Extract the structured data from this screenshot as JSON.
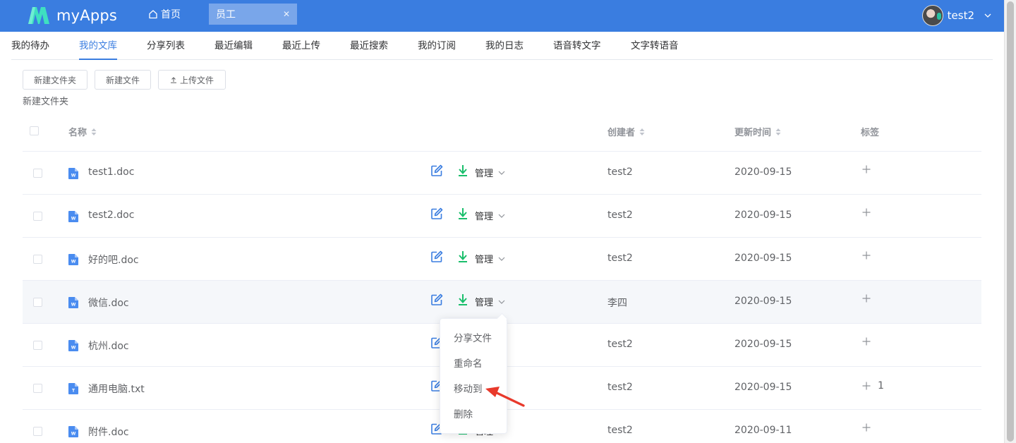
{
  "header": {
    "logo_text": "myApps",
    "home_label": "首页",
    "active_tab": "员工",
    "close_glyph": "✕",
    "username": "test2",
    "bar_color": "#3a7de0"
  },
  "nav": {
    "tabs": [
      {
        "label": "我的待办"
      },
      {
        "label": "我的文库"
      },
      {
        "label": "分享列表"
      },
      {
        "label": "最近编辑"
      },
      {
        "label": "最近上传"
      },
      {
        "label": "最近搜索"
      },
      {
        "label": "我的订阅"
      },
      {
        "label": "我的日志"
      },
      {
        "label": "语音转文字"
      },
      {
        "label": "文字转语音"
      }
    ],
    "active": "我的文库"
  },
  "toolbar": {
    "new_folder": "新建文件夹",
    "new_file": "新建文件",
    "upload": "上传文件"
  },
  "breadcrumb": "新建文件夹",
  "table": {
    "columns": {
      "name": "名称",
      "creator": "创建者",
      "updated": "更新时间",
      "tags": "标签"
    },
    "manage_label": "管理",
    "rows": [
      {
        "name": "test1.doc",
        "type": "doc",
        "creator": "test2",
        "updated": "2020-09-15",
        "tag_count": ""
      },
      {
        "name": "test2.doc",
        "type": "doc",
        "creator": "test2",
        "updated": "2020-09-15",
        "tag_count": ""
      },
      {
        "name": "好的吧.doc",
        "type": "doc",
        "creator": "test2",
        "updated": "2020-09-15",
        "tag_count": ""
      },
      {
        "name": "微信.doc",
        "type": "doc",
        "creator": "李四",
        "updated": "2020-09-15",
        "tag_count": ""
      },
      {
        "name": "杭州.doc",
        "type": "doc",
        "creator": "test2",
        "updated": "2020-09-15",
        "tag_count": ""
      },
      {
        "name": "通用电脑.txt",
        "type": "txt",
        "creator": "test2",
        "updated": "2020-09-15",
        "tag_count": "1"
      },
      {
        "name": "附件.doc",
        "type": "doc",
        "creator": "test2",
        "updated": "2020-09-11",
        "tag_count": ""
      }
    ]
  },
  "manage_menu": {
    "items": [
      "分享文件",
      "重命名",
      "移动到",
      "删除"
    ]
  },
  "colors": {
    "accent": "#3a7de0",
    "download": "#19be6b",
    "annotation_arrow": "#e8392b"
  }
}
